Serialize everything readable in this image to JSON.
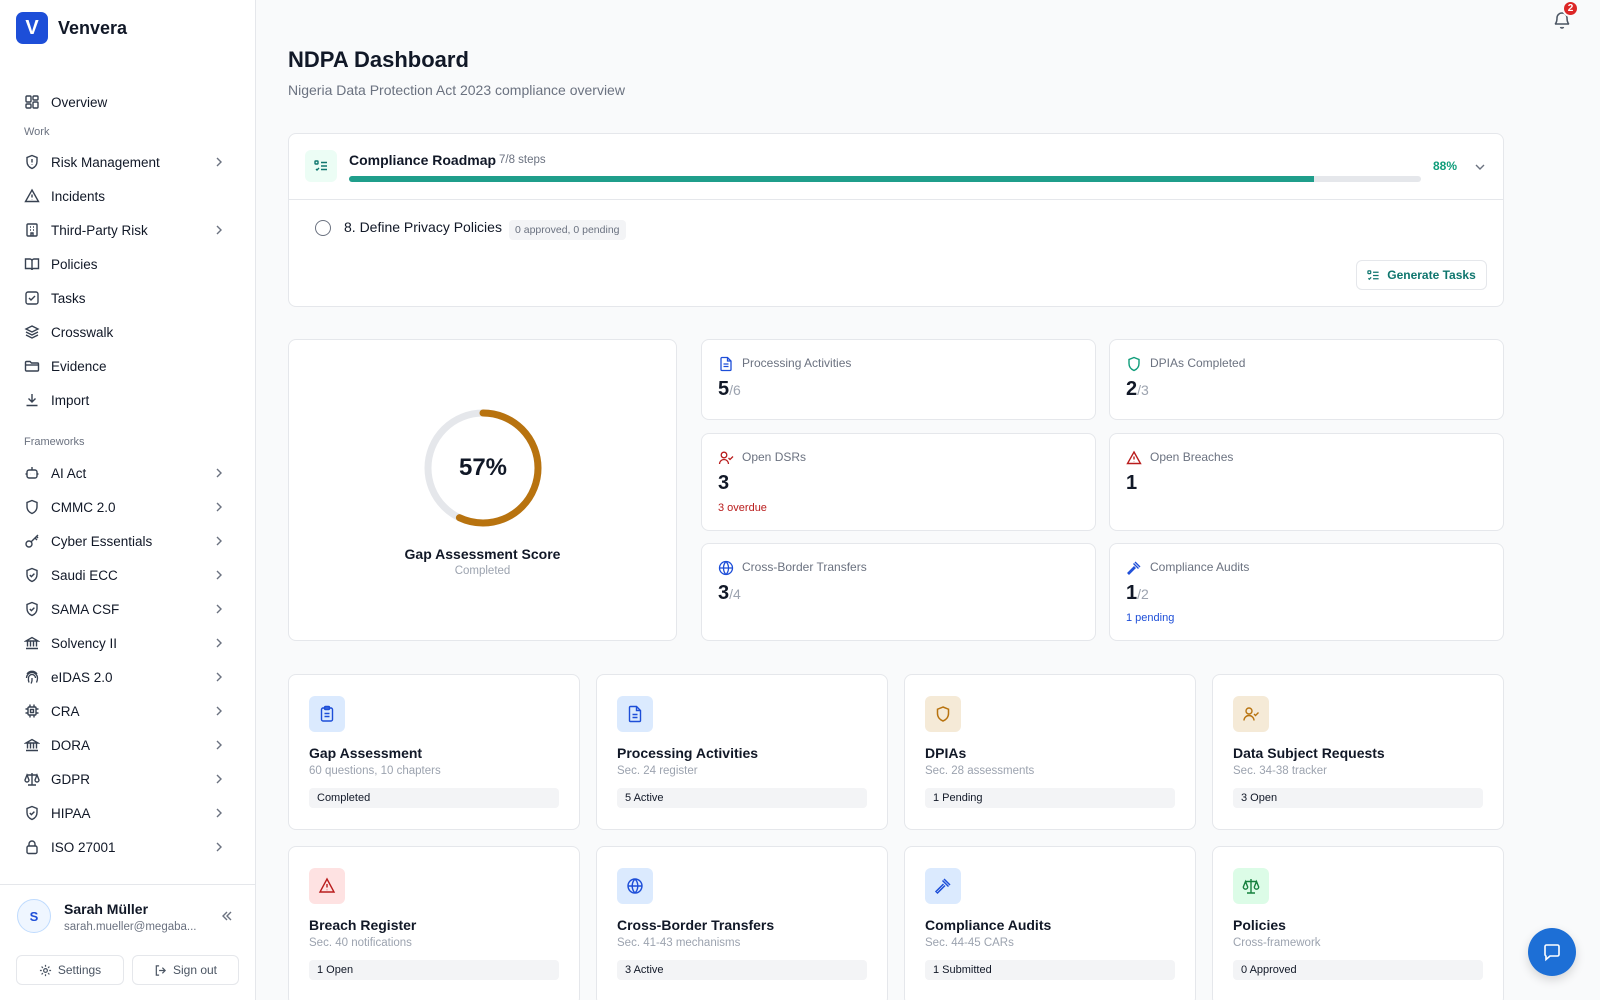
{
  "app": {
    "name": "Venvera",
    "logo_letter": "V"
  },
  "sidebar": {
    "overview": "Overview",
    "work_label": "Work",
    "work_items": [
      {
        "label": "Risk Management",
        "icon": "shield-alert-icon",
        "has_chevron": true
      },
      {
        "label": "Incidents",
        "icon": "warning-icon",
        "has_chevron": false
      },
      {
        "label": "Third-Party Risk",
        "icon": "building-icon",
        "has_chevron": true
      },
      {
        "label": "Policies",
        "icon": "book-icon",
        "has_chevron": false
      },
      {
        "label": "Tasks",
        "icon": "checkbox-icon",
        "has_chevron": false
      },
      {
        "label": "Crosswalk",
        "icon": "layers-icon",
        "has_chevron": false
      },
      {
        "label": "Evidence",
        "icon": "folder-icon",
        "has_chevron": false
      },
      {
        "label": "Import",
        "icon": "download-icon",
        "has_chevron": false
      }
    ],
    "frameworks_label": "Frameworks",
    "framework_items": [
      {
        "label": "AI Act",
        "icon": "bot-icon"
      },
      {
        "label": "CMMC 2.0",
        "icon": "shield-icon"
      },
      {
        "label": "Cyber Essentials",
        "icon": "key-icon"
      },
      {
        "label": "Saudi ECC",
        "icon": "shield-check-icon"
      },
      {
        "label": "SAMA CSF",
        "icon": "shield-check-icon"
      },
      {
        "label": "Solvency II",
        "icon": "bank-icon"
      },
      {
        "label": "eIDAS 2.0",
        "icon": "fingerprint-icon"
      },
      {
        "label": "CRA",
        "icon": "chip-icon"
      },
      {
        "label": "DORA",
        "icon": "bank-icon"
      },
      {
        "label": "GDPR",
        "icon": "scale-icon"
      },
      {
        "label": "HIPAA",
        "icon": "shield-check-icon"
      },
      {
        "label": "ISO 27001",
        "icon": "lock-icon"
      }
    ],
    "user": {
      "initial": "S",
      "name": "Sarah Müller",
      "email": "sarah.mueller@megaba...",
      "settings": "Settings",
      "sign_out": "Sign out"
    }
  },
  "header": {
    "notification_count": "2",
    "title": "NDPA Dashboard",
    "subtitle": "Nigeria Data Protection Act 2023 compliance overview"
  },
  "roadmap": {
    "title": "Compliance Roadmap",
    "steps": "7/8 steps",
    "percent_label": "88%",
    "progress": 0.9,
    "current_step": "8. Define Privacy Policies",
    "step_status": "0 approved, 0 pending",
    "generate_button": "Generate Tasks"
  },
  "score": {
    "value": 57,
    "label": "57%",
    "title": "Gap Assessment Score",
    "status": "Completed"
  },
  "stats": [
    {
      "label": "Processing Activities",
      "value": "5",
      "denominator": "/6",
      "note": "",
      "icon": "file-text-icon"
    },
    {
      "label": "DPIAs Completed",
      "value": "2",
      "denominator": "/3",
      "note": "",
      "icon": "shield-icon"
    },
    {
      "label": "Open DSRs",
      "value": "3",
      "denominator": "",
      "note": "3 overdue",
      "icon": "user-check-icon"
    },
    {
      "label": "Open Breaches",
      "value": "1",
      "denominator": "",
      "note": "",
      "icon": "warning-icon"
    },
    {
      "label": "Cross-Border Transfers",
      "value": "3",
      "denominator": "/4",
      "note": "",
      "icon": "globe-icon"
    },
    {
      "label": "Compliance Audits",
      "value": "1",
      "denominator": "/2",
      "note": "1 pending",
      "icon": "gavel-icon"
    }
  ],
  "modules": [
    {
      "title": "Gap Assessment",
      "subtitle": "60 questions, 10 chapters",
      "badge": "Completed",
      "icon": "clipboard-icon"
    },
    {
      "title": "Processing Activities",
      "subtitle": "Sec. 24 register",
      "badge": "5 Active",
      "icon": "file-text-icon"
    },
    {
      "title": "DPIAs",
      "subtitle": "Sec. 28 assessments",
      "badge": "1 Pending",
      "icon": "shield-icon"
    },
    {
      "title": "Data Subject Requests",
      "subtitle": "Sec. 34-38 tracker",
      "badge": "3 Open",
      "icon": "user-check-icon"
    },
    {
      "title": "Breach Register",
      "subtitle": "Sec. 40 notifications",
      "badge": "1 Open",
      "icon": "warning-icon"
    },
    {
      "title": "Cross-Border Transfers",
      "subtitle": "Sec. 41-43 mechanisms",
      "badge": "3 Active",
      "icon": "globe-icon"
    },
    {
      "title": "Compliance Audits",
      "subtitle": "Sec. 44-45 CARs",
      "badge": "1 Submitted",
      "icon": "gavel-icon"
    },
    {
      "title": "Policies",
      "subtitle": "Cross-framework",
      "badge": "0 Approved",
      "icon": "scale-icon"
    }
  ],
  "colors": {
    "accent": "#1d4ed8",
    "teal": "#1f9e8b",
    "score_ring": "#b8730f",
    "danger": "#b91c1c"
  }
}
